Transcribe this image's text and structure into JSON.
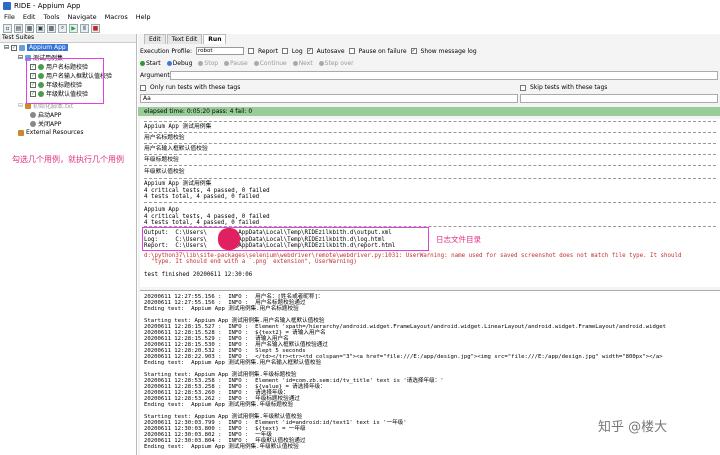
{
  "window": {
    "title": "RIDE - Appium App"
  },
  "menu": [
    "File",
    "Edit",
    "Tools",
    "Navigate",
    "Macros",
    "Help"
  ],
  "toolbar_icons": [
    "new-icon",
    "open-icon",
    "open-dir-icon",
    "save-icon",
    "save-all-icon",
    "search-icon",
    "run-icon",
    "pause-icon",
    "stop-icon"
  ],
  "left": {
    "tab": "Test Suites",
    "tree": [
      {
        "label": "Appium App",
        "selected": true,
        "checked": true
      },
      {
        "label": "测试用例集"
      },
      {
        "label": "用户名标题校验",
        "checked": true
      },
      {
        "label": "用户名输入框默认值校验",
        "checked": true
      },
      {
        "label": "年级标题校验",
        "checked": true
      },
      {
        "label": "年级默认值校验",
        "checked": true
      },
      {
        "label": "初始化脚本.txt"
      },
      {
        "label": "启动APP"
      },
      {
        "label": "关闭APP"
      },
      {
        "label": "External Resources"
      }
    ],
    "note": "勾选几个用例，就执行几个用例"
  },
  "right": {
    "tabs": [
      "Edit",
      "Text Edit",
      "Run"
    ],
    "profile_label": "Execution Profile:",
    "profile_value": "robot",
    "options": {
      "report": "Report",
      "log": "Log",
      "autosave": "Autosave",
      "pause": "Pause on failure",
      "show_msg": "Show message log"
    },
    "buttons": {
      "start": "Start",
      "debug": "Debug",
      "stop": "Stop",
      "pause": "Pause",
      "continue": "Continue",
      "next": "Next",
      "step_over": "Step over"
    },
    "arguments_label": "Arguments:",
    "only_run": "Only run tests with these tags",
    "skip": "Skip tests with these tags",
    "tags_value": "Aa",
    "status": "elapsed time: 0:05:20    pass: 4    fail: 0"
  },
  "output": {
    "suite_line1": "Appium App 测试用例集",
    "test1": "用户名标题校验",
    "test2": "用户名输入框默认值校验",
    "test3": "年级标题校验",
    "test4": "年级默认值校验",
    "summary_title": "Appium App 测试用例集",
    "summary1": "4 critical tests, 4 passed, 0 failed",
    "summary2": "4 tests total, 4 passed, 0 failed",
    "summary_title2": "Appium App",
    "summary3": "4 critical tests, 4 passed, 0 failed",
    "summary4": "4 tests total, 4 passed, 0 failed",
    "out_output": "Output:  C:\\Users\\        \\AppData\\Local\\Temp\\RIDEzilkbith.d\\output.xml",
    "out_log": "Log:     C:\\Users\\        \\AppData\\Local\\Temp\\RIDEzilkbith.d\\log.html",
    "out_report": "Report:  C:\\Users\\        \\AppData\\Local\\Temp\\RIDEzilkbith.d\\report.html",
    "warn1": "d:\\python37\\lib\\site-packages\\selenium\\webdriver\\remote\\webdriver.py:1031: UserWarning: name used for saved screenshot does not match file type. It should",
    "warn2": "  \"type. It should end with a `.png` extension\", UserWarning)",
    "finished": "test finished 20200611 12:30:06",
    "log_note": "日志文件目录"
  },
  "log": [
    "20200611 12:27:55.156 :  INFO :  用户名：[姓名或者昵称]：",
    "20200611 12:27:55.156 :  INFO :  用户名标题校验通过",
    "Ending test:  Appium App 测试用例集.用户名标题校验",
    "",
    "Starting test: Appium App 测试用例集.用户名输入框默认值校验",
    "20200611 12:28:15.527 :  INFO :  Element 'xpath=/hierarchy/android.widget.FrameLayout/android.widget.LinearLayout/android.widget.FrameLayout/android.widget",
    "20200611 12:28:15.528 :  INFO :  ${text2} = 请输入用户名",
    "20200611 12:28:15.529 :  INFO :  请输入用户名",
    "20200611 12:28:15.530 :  INFO :  用户名输入框默认值校验通过",
    "20200611 12:28:20.532 :  INFO :  Slept 5 seconds",
    "20200611 12:28:22.903 :  INFO :  </td></tr><tr><td colspan=\"3\"><a href=\"file:///E:/app/design.jpg\"><img src=\"file:///E:/app/design.jpg\" width=\"800px\"></a>",
    "Ending test:  Appium App 测试用例集.用户名输入框默认值校验",
    "",
    "Starting test: Appium App 测试用例集.年级标题校验",
    "20200611 12:28:53.258 :  INFO :  Element 'id=com.zb.sem:id/tv_title' text is '请选择年级：'",
    "20200611 12:28:53.258 :  INFO :  ${value} = 请选择年级：",
    "20200611 12:28:53.260 :  INFO :  请选择年级：",
    "20200611 12:28:53.262 :  INFO :  年级标题校验通过",
    "Ending test:  Appium App 测试用例集.年级标题校验",
    "",
    "Starting test: Appium App 测试用例集.年级默认值校验",
    "20200611 12:30:03.799 :  INFO :  Element 'id=android:id/text1' text is '一年级'",
    "20200611 12:30:03.800 :  INFO :  ${text} = 一年级",
    "20200611 12:30:03.802 :  INFO :  一年级",
    "20200611 12:30:03.804 :  INFO :  年级默认值校验通过",
    "Ending test:  Appium App 测试用例集.年级默认值校验"
  ],
  "watermark": "知乎 @楼大"
}
